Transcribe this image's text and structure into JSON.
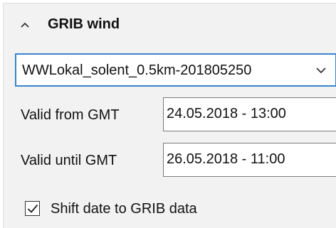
{
  "section": {
    "title": "GRIB wind",
    "collapse_icon": "chevron-up-icon"
  },
  "dropdown": {
    "selected_value": "WWLokal_solent_0.5km-201805250",
    "arrow_icon": "chevron-down-icon"
  },
  "valid_from": {
    "label": "Valid from GMT",
    "value": "24.05.2018 - 13:00"
  },
  "valid_until": {
    "label": "Valid until GMT",
    "value": "26.05.2018 - 11:00"
  },
  "shift_date": {
    "label": "Shift date to GRIB data",
    "checked": true
  },
  "colors": {
    "panel_background": "#f2f2f2",
    "dropdown_border_accent": "#3a84c9"
  }
}
